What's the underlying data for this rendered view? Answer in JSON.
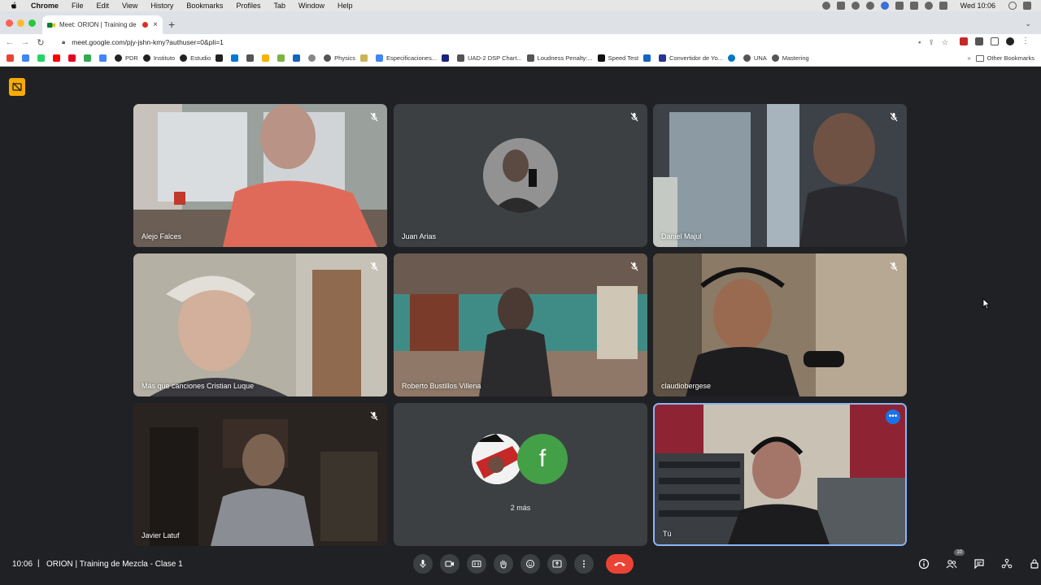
{
  "menubar": {
    "app": "Chrome",
    "items": [
      "File",
      "Edit",
      "View",
      "History",
      "Bookmarks",
      "Profiles",
      "Tab",
      "Window",
      "Help"
    ],
    "clock": "Wed 10:06"
  },
  "browser": {
    "tab_title": "Meet: ORION | Training de",
    "url": "meet.google.com/pjy-jshn-kmy?authuser=0&pli=1"
  },
  "bookmarks": {
    "items": [
      {
        "label": "",
        "icon": "gmail-icon",
        "color": "#ea4335"
      },
      {
        "label": "",
        "icon": "calendar-icon",
        "color": "#4285f4"
      },
      {
        "label": "",
        "icon": "whatsapp-icon",
        "color": "#25d366"
      },
      {
        "label": "",
        "icon": "youtube-icon",
        "color": "#ff0000"
      },
      {
        "label": "",
        "icon": "pinterest-icon",
        "color": "#e60023"
      },
      {
        "label": "",
        "icon": "maps-icon",
        "color": "#34a853"
      },
      {
        "label": "",
        "icon": "translate-icon",
        "color": "#4285f4"
      },
      {
        "label": "PDR",
        "icon": "headphones-icon",
        "color": "#222222"
      },
      {
        "label": "Instituto",
        "icon": "headphones-icon",
        "color": "#222222"
      },
      {
        "label": "Estudio",
        "icon": "mic-icon",
        "color": "#222222"
      },
      {
        "label": "",
        "icon": "wb-icon",
        "color": "#222222"
      },
      {
        "label": "",
        "icon": "outlook-icon",
        "color": "#0078d4"
      },
      {
        "label": "",
        "icon": "safari-icon",
        "color": "#555555"
      },
      {
        "label": "",
        "icon": "folder-icon",
        "color": "#f4b400"
      },
      {
        "label": "",
        "icon": "gear-box-icon",
        "color": "#7cb342"
      },
      {
        "label": "",
        "icon": "book-icon",
        "color": "#1565c0"
      },
      {
        "label": "",
        "icon": "spinner-icon",
        "color": "#888888"
      },
      {
        "label": "Physics",
        "icon": "globe-icon",
        "color": "#555555"
      },
      {
        "label": "",
        "icon": "pie-icon",
        "color": "#c9b458"
      },
      {
        "label": "Especificaciones...",
        "icon": "google-icon",
        "color": "#4285f4"
      },
      {
        "label": "",
        "icon": "uad-icon",
        "color": "#1a237e"
      },
      {
        "label": "UAD-2 DSP Chart...",
        "icon": "gear-icon",
        "color": "#555555"
      },
      {
        "label": "Loudness Penalty:...",
        "icon": "wave-icon",
        "color": "#555555"
      },
      {
        "label": "Speed Test",
        "icon": "m-icon",
        "color": "#111111"
      },
      {
        "label": "",
        "icon": "infinity-icon",
        "color": "#1565c0"
      },
      {
        "label": "Convertidor de Yo...",
        "icon": "shield-icon",
        "color": "#283593"
      },
      {
        "label": "",
        "icon": "ring-icon",
        "color": "#0277bd"
      },
      {
        "label": "UNA",
        "icon": "globe-icon",
        "color": "#555555"
      },
      {
        "label": "Mastering",
        "icon": "globe-icon",
        "color": "#555555"
      }
    ],
    "other": "Other Bookmarks"
  },
  "participants": [
    {
      "name": "Alejo Falces",
      "type": "video",
      "muted": true,
      "bg": "#8a8f8a"
    },
    {
      "name": "Juan Arias",
      "type": "avatar",
      "muted": true,
      "bg": "#3c4043"
    },
    {
      "name": "Daniel Majul",
      "type": "video",
      "muted": true,
      "bg": "#4a4f55"
    },
    {
      "name": "Más que canciones Cristian Luque",
      "type": "video",
      "muted": true,
      "bg": "#b9b5a8"
    },
    {
      "name": "Roberto Bustillos Villena",
      "type": "video",
      "muted": true,
      "bg": "#3a7f7a"
    },
    {
      "name": "claudiobergese",
      "type": "video",
      "muted": true,
      "bg": "#7a6d5d"
    },
    {
      "name": "Javier Latuf",
      "type": "video",
      "muted": true,
      "bg": "#2c2622"
    },
    {
      "name": "",
      "type": "more",
      "muted": false,
      "bg": "#3c4043"
    },
    {
      "name": "Tú",
      "type": "self",
      "muted": false,
      "bg": "#8e2433"
    }
  ],
  "more_tile": {
    "letter": "f",
    "text": "2 más"
  },
  "bottom": {
    "time": "10:06",
    "separator": "|",
    "meeting_title": "ORION | Training de Mezcla - Clase 1",
    "people_count": "10"
  },
  "colors": {
    "background": "#202124",
    "end_call": "#ea4335",
    "active_border": "#8ab4f8",
    "badge": "#f9ab00"
  }
}
